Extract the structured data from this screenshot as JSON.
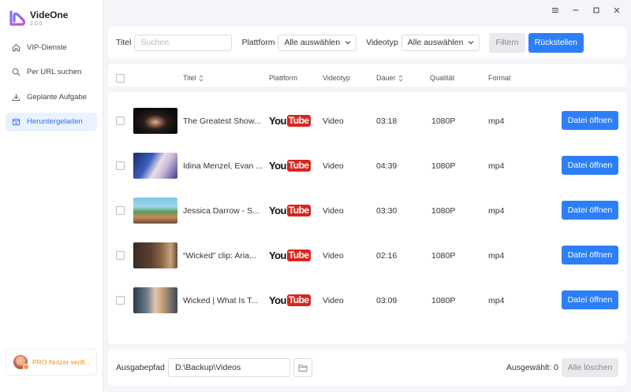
{
  "app": {
    "name": "VideOne",
    "version": "2.0.0",
    "brand_color": "#2d7ff9"
  },
  "window_controls": {
    "menu_icon": "menu-icon",
    "minimize_icon": "minimize-icon",
    "maximize_icon": "maximize-icon",
    "close_icon": "close-icon"
  },
  "sidebar": {
    "items": [
      {
        "label": "VIP-Dienste",
        "icon": "home-icon",
        "active": false
      },
      {
        "label": "Per URL suchen",
        "icon": "search-icon",
        "active": false
      },
      {
        "label": "Geplante Aufgabe",
        "icon": "download-icon",
        "active": false
      },
      {
        "label": "Heruntergeladen",
        "icon": "downloaded-box-icon",
        "active": true
      }
    ],
    "pro_user": "PRO-Nutzer verifi..."
  },
  "filter": {
    "title_label": "Titel",
    "search_placeholder": "Suchen",
    "platform_label": "Plattform",
    "platform_value": "Alle auswählen",
    "videotype_label": "Videotyp",
    "videotype_value": "Alle auswählen",
    "filter_button": "Filtern",
    "reset_button": "Rückstellen"
  },
  "table": {
    "columns": [
      "Titel",
      "Plattform",
      "Videotyp",
      "Dauer",
      "Qualität",
      "Format"
    ],
    "platform_logo": {
      "you": "You",
      "tube": "Tube"
    },
    "open_label": "Datei öffnen",
    "rows": [
      {
        "title": "The Greatest Show...",
        "videotype": "Video",
        "duration": "03:18",
        "quality": "1080P",
        "format": "mp4"
      },
      {
        "title": "Idina Menzel, Evan ...",
        "videotype": "Video",
        "duration": "04:39",
        "quality": "1080P",
        "format": "mp4"
      },
      {
        "title": "Jessica Darrow - S...",
        "videotype": "Video",
        "duration": "03:30",
        "quality": "1080P",
        "format": "mp4"
      },
      {
        "title": "“Wicked” clip: Aria...",
        "videotype": "Video",
        "duration": "02:16",
        "quality": "1080P",
        "format": "mp4"
      },
      {
        "title": "Wicked | What Is T...",
        "videotype": "Video",
        "duration": "03:09",
        "quality": "1080P",
        "format": "mp4"
      }
    ]
  },
  "footer": {
    "output_label": "Ausgabepfad",
    "output_path": "D:\\Backup\\Videos",
    "selected_label": "Ausgewählt: 0",
    "clear_button": "Alle löschen"
  }
}
